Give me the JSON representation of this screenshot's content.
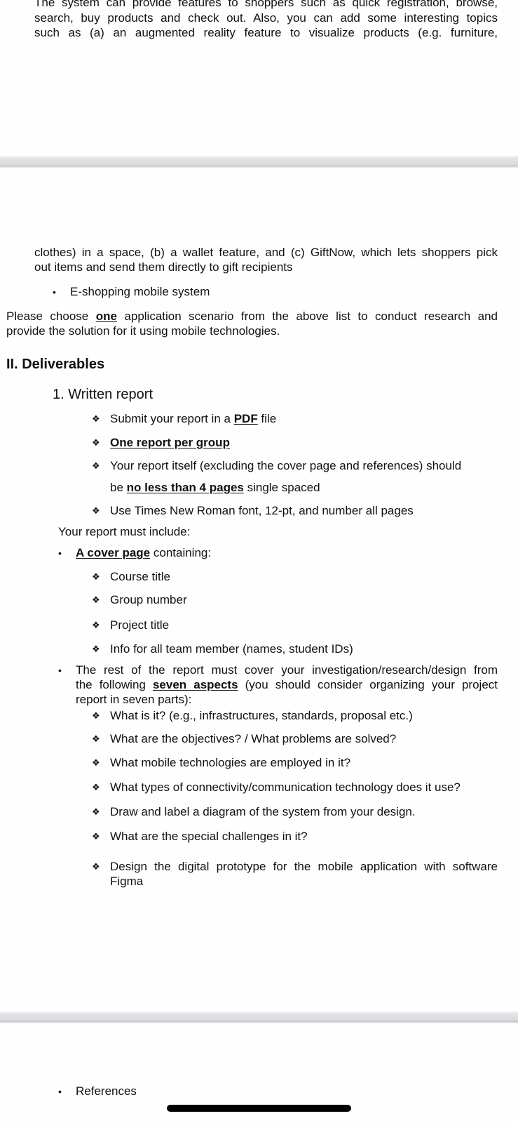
{
  "page1": {
    "intro_lines": [
      "The system can provide features to shoppers such as quick registration, browse,",
      "search, buy products and check out. Also, you can add some interesting topics",
      "such as (a) an augmented reality feature to visualize products (e.g. furniture,"
    ]
  },
  "page2": {
    "continued_lines": [
      "clothes) in a space, (b) a wallet feature, and (c) GiftNow, which lets shoppers pick",
      "out items and send them directly to gift recipients"
    ],
    "scenario_bullet": "E-shopping mobile system",
    "choose": {
      "before": "Please choose ",
      "emphasis": "one",
      "after": " application scenario from the above list to conduct research and",
      "line2": "provide the solution for it using mobile technologies."
    },
    "section_title": "II. Deliverables",
    "subsection_title": "1. Written report",
    "report_rules": {
      "r1_before": "Submit your report in a ",
      "r1_emphasis": "PDF",
      "r1_after": " file",
      "r2_emphasis": "One report per group",
      "r3_line1": "Your report itself (excluding the cover page and references) should",
      "r3_before": "be ",
      "r3_emphasis": "no less than 4 pages",
      "r3_after": " single spaced",
      "r4": "Use Times New Roman font, 12-pt, and number all pages"
    },
    "must_include": "Your report must include:",
    "cover": {
      "emphasis": "A cover page",
      "after": " containing:",
      "items": [
        "Course title",
        "Group number",
        "Project title",
        "Info for all team member (names, student IDs)"
      ]
    },
    "rest": {
      "line1": "The rest of the report must cover your investigation/research/design from",
      "line2_before": "the following ",
      "line2_emphasis": "seven aspects",
      "line2_after": " (you should consider organizing your project",
      "line3": "report in seven parts):",
      "aspects": [
        "What is it? (e.g., infrastructures, standards, proposal etc.)",
        "What are the objectives? / What problems are solved?",
        "What mobile technologies are employed in it?",
        "What types of connectivity/communication technology does it use?",
        "Draw and label a diagram of the system from your design.",
        "What are the special challenges in it?"
      ],
      "last_aspect_line1": "Design the digital prototype for the mobile application with software",
      "last_aspect_line2": "Figma"
    }
  },
  "page3": {
    "references_bullet": "References"
  },
  "icons": {
    "diamond_bullet": "❖",
    "round_bullet": "•"
  }
}
